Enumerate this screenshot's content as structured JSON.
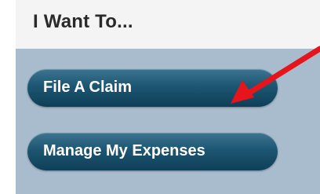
{
  "panel": {
    "title": "I Want To...",
    "actions": [
      {
        "label": "File A Claim"
      },
      {
        "label": "Manage My Expenses"
      }
    ]
  },
  "annotation": {
    "type": "arrow",
    "color": "#e8141b",
    "points_to": "File A Claim"
  },
  "colors": {
    "panel_header_bg": "#f4f4f4",
    "panel_body_bg": "#a8bccd",
    "button_bg": "#1d5672",
    "button_text": "#ffffff",
    "title_text": "#2a2a2a"
  }
}
